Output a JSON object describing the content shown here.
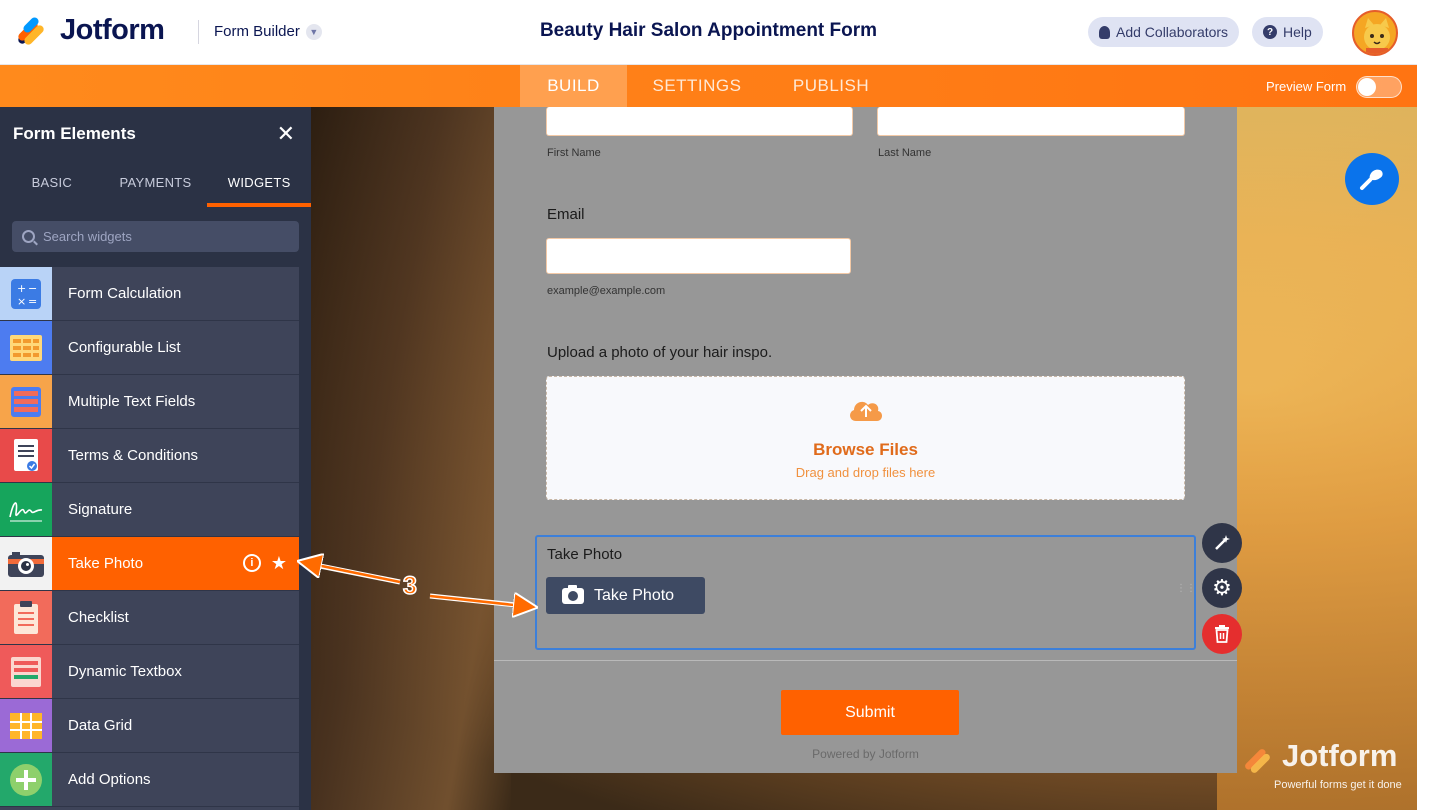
{
  "header": {
    "brand": "Jotform",
    "builder_label": "Form Builder",
    "form_title": "Beauty Hair Salon Appointment Form",
    "add_collaborators": "Add Collaborators",
    "help": "Help"
  },
  "nav": {
    "tabs": [
      {
        "label": "BUILD",
        "active": true
      },
      {
        "label": "SETTINGS",
        "active": false
      },
      {
        "label": "PUBLISH",
        "active": false
      }
    ],
    "preview_label": "Preview Form",
    "preview_on": false
  },
  "sidebar": {
    "title": "Form Elements",
    "tabs": [
      {
        "label": "BASIC"
      },
      {
        "label": "PAYMENTS"
      },
      {
        "label": "WIDGETS",
        "active": true
      }
    ],
    "search_placeholder": "Search widgets",
    "items": [
      {
        "label": "Form Calculation",
        "icon": "calculator-icon",
        "color": "#3b7be4"
      },
      {
        "label": "Configurable List",
        "icon": "list-grid-icon",
        "color": "#4d7cf0"
      },
      {
        "label": "Multiple Text Fields",
        "icon": "text-fields-icon",
        "color": "#f7a44a"
      },
      {
        "label": "Terms & Conditions",
        "icon": "document-check-icon",
        "color": "#e84a4a"
      },
      {
        "label": "Signature",
        "icon": "signature-icon",
        "color": "#16a55c"
      },
      {
        "label": "Take Photo",
        "icon": "camera-icon",
        "color": "#f2f2f2",
        "active": true
      },
      {
        "label": "Checklist",
        "icon": "clipboard-icon",
        "color": "#f26b5b"
      },
      {
        "label": "Dynamic Textbox",
        "icon": "textbox-icon",
        "color": "#ef5a5a"
      },
      {
        "label": "Data Grid",
        "icon": "grid-icon",
        "color": "#9b6ad6"
      },
      {
        "label": "Add Options",
        "icon": "plus-circle-icon",
        "color": "#23a86b"
      }
    ]
  },
  "form": {
    "first_name_sub": "First Name",
    "last_name_sub": "Last Name",
    "email_label": "Email",
    "email_sub": "example@example.com",
    "upload_label": "Upload a photo of your hair inspo.",
    "upload_title": "Browse Files",
    "upload_sub": "Drag and drop files here",
    "take_photo_label": "Take Photo",
    "take_photo_button": "Take Photo",
    "submit": "Submit",
    "powered": "Powered by Jotform"
  },
  "annotation": {
    "step": "3"
  },
  "watermark": {
    "brand": "Jotform",
    "tagline": "Powerful forms get it done"
  },
  "colors": {
    "brand_orange": "#ff6100",
    "brand_navy": "#0a1551",
    "selection_blue": "#3c7fd9"
  }
}
